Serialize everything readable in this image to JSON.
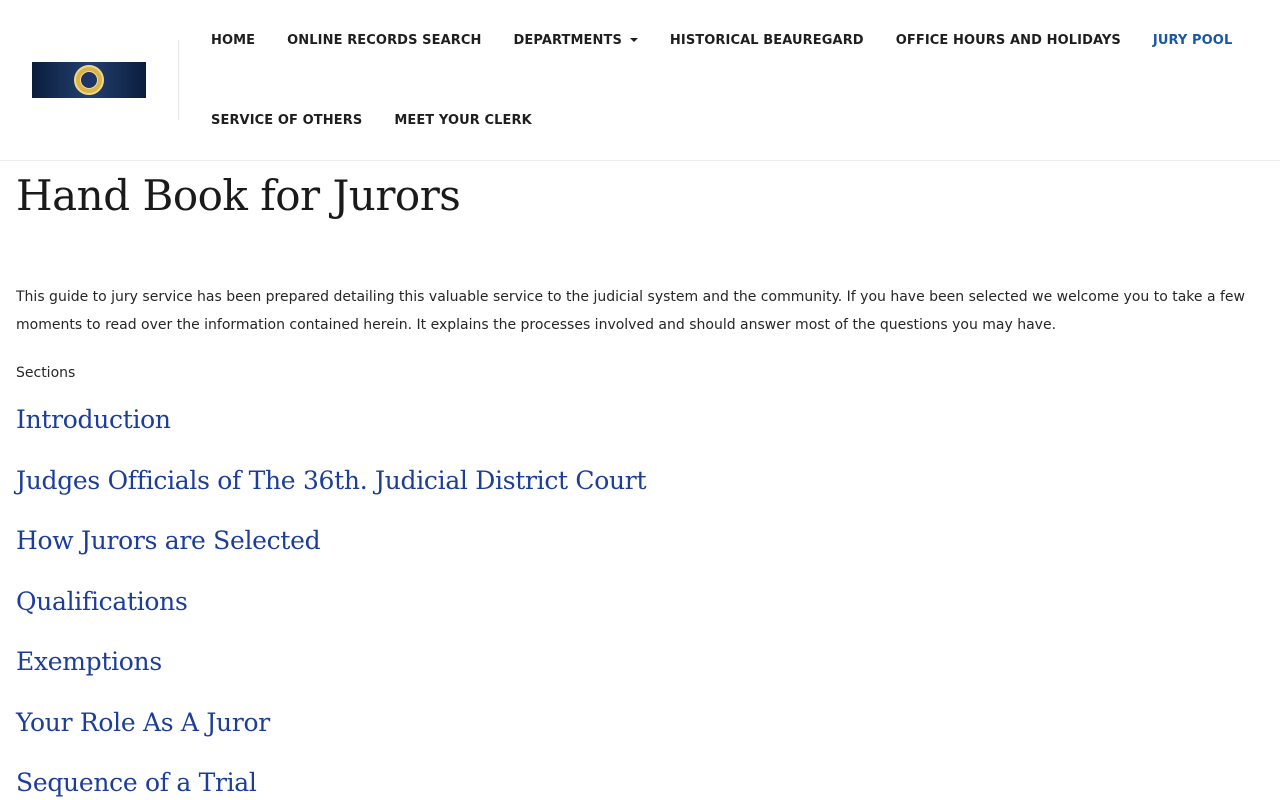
{
  "header": {
    "nav_row1": [
      {
        "label": "HOME",
        "active": false
      },
      {
        "label": "ONLINE RECORDS SEARCH",
        "active": false
      },
      {
        "label": "DEPARTMENTS",
        "active": false,
        "dropdown": true
      },
      {
        "label": "HISTORICAL BEAUREGARD",
        "active": false
      },
      {
        "label": "OFFICE HOURS AND HOLIDAYS",
        "active": false
      },
      {
        "label": "JURY POOL",
        "active": true
      }
    ],
    "nav_row2": [
      {
        "label": "SERVICE OF OTHERS",
        "active": false
      },
      {
        "label": "MEET YOUR CLERK",
        "active": false
      }
    ],
    "icons": {
      "logo": "parish-seal-logo",
      "dropdown": "caret-down-icon"
    }
  },
  "main": {
    "title": "Hand Book for Jurors",
    "intro": "This guide to jury service has been prepared detailing this valuable service to the judicial system and the community. If you have been selected we welcome you to take a few moments to read over the information contained herein. It explains the processes involved and should answer most of the questions you may have.",
    "sections_label": "Sections",
    "sections": [
      "Introduction",
      "Judges Officials of The 36th. Judicial District Court",
      "How Jurors are Selected",
      "Qualifications",
      "Exemptions",
      "Your Role As A Juror",
      "Sequence of a Trial"
    ]
  },
  "colors": {
    "accent": "#1b56a5",
    "link": "#1c3d99",
    "logo_bg": "#0b1d3d"
  }
}
